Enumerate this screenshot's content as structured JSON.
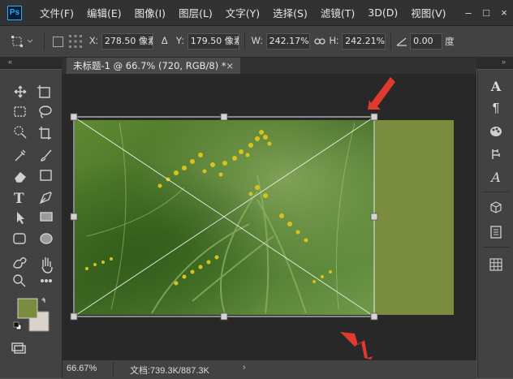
{
  "menu": {
    "logo": "Ps",
    "items": [
      "文件(F)",
      "编辑(E)",
      "图像(I)",
      "图层(L)",
      "文字(Y)",
      "选择(S)",
      "滤镜(T)",
      "3D(D)",
      "视图(V)"
    ],
    "window_controls": [
      "–",
      "□",
      "×"
    ]
  },
  "options": {
    "x_label": "X:",
    "x_value": "278.50 像素",
    "delta_symbol": "Δ",
    "y_label": "Y:",
    "y_value": "179.50 像素",
    "w_label": "W:",
    "w_value": "242.17%",
    "link_icon": "link-icon",
    "h_label": "H:",
    "h_value": "242.21%",
    "angle_icon": "angle-icon",
    "angle_value": "0.00",
    "angle_unit": "度"
  },
  "document": {
    "tab_label": "未标题-1 @ 66.7% (720, RGB/8) *",
    "close": "×"
  },
  "status": {
    "zoom": "66.67%",
    "doc_info": "文档:739.3K/887.3K",
    "arrow": "›"
  },
  "colors": {
    "foreground": "#7a8c3e",
    "background": "#d9d3c9",
    "arrow_red": "#e03a2e",
    "fill_rect": "#7a8c3e"
  },
  "tools": {
    "left": [
      "move-icon",
      "artboard-icon",
      "marquee-icon",
      "lasso-icon",
      "quick-select-icon",
      "crop-icon",
      "eyedropper-icon",
      "brush-icon",
      "eraser-icon",
      "gradient-icon",
      "type-icon",
      "pen-icon",
      "path-select-icon",
      "rectangle-icon",
      "rounded-rect-icon",
      "ellipse-icon",
      "custom-shape-icon",
      "hand-icon",
      "zoom-icon",
      "more-icon"
    ],
    "right": [
      "character-icon",
      "paragraph-icon",
      "swatches-icon",
      "history-icon",
      "glyphs-icon",
      "3d-icon",
      "properties-icon",
      "grid-icon"
    ]
  }
}
